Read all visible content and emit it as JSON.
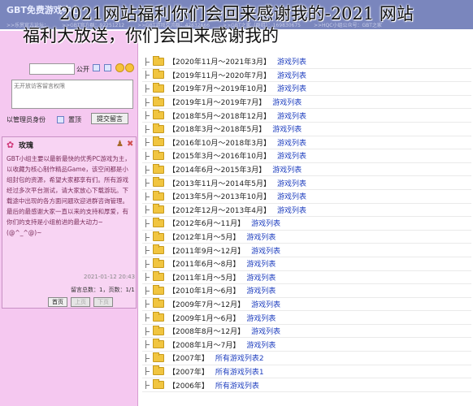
{
  "caption": {
    "line1": "2021网站福利你们会回来感谢我的-2021 网站",
    "line2": "福利大放送，你们会回来感谢我的"
  },
  "header": {
    "logo_text": "GBT免费游戏中心",
    "info_items": [
      ">>乐赏官方论坛：",
      ">>GBT官方群：92251212",
      ">>GBT游戏交流群：42632666",
      ">>GBT之家（群组）：169830675",
      ">>HQC小组公众号：GBT之家"
    ]
  },
  "sidebar": {
    "public_label": "公开",
    "textarea_placeholder": "无开放访客留言权限",
    "admin_only_label": "以管理员身份",
    "pin_label": "置顶",
    "submit_label": "提交留言",
    "message": {
      "author": "玫瑰",
      "text": "GBT小组主要以最新最快的优秀PC游戏为主，以收藏为核心制作精品Game，该空间都是小组封包的资源，希望大家都享有们。所有游戏经过多次平台测试，请大家放心下载游玩。下载途中出现的各方面问题欢迎进群咨询管理。最后的最感谢大家一直以来的支持和厚爱，有你们的支持是小组前进的最大动力~(@^_^@)~",
      "time": "2021-01-12 20:43",
      "stats": "留言总数：1，页数：1/1"
    },
    "pager": {
      "first": "首页",
      "prev": "上页",
      "next": "下页"
    }
  },
  "file_list": {
    "link_label": "游戏列表",
    "rows": [
      {
        "period": "【2020年11月～2021年3月】",
        "link": "游戏列表"
      },
      {
        "period": "【2019年11月～2020年7月】",
        "link": "游戏列表"
      },
      {
        "period": "【2019年7月～2019年10月】",
        "link": "游戏列表"
      },
      {
        "period": "【2019年1月～2019年7月】",
        "link": "游戏列表"
      },
      {
        "period": "【2018年5月～2018年12月】",
        "link": "游戏列表"
      },
      {
        "period": "【2018年3月～2018年5月】",
        "link": "游戏列表"
      },
      {
        "period": "【2016年10月～2018年3月】",
        "link": "游戏列表"
      },
      {
        "period": "【2015年3月～2016年10月】",
        "link": "游戏列表"
      },
      {
        "period": "【2014年6月～2015年3月】",
        "link": "游戏列表"
      },
      {
        "period": "【2013年11月～2014年5月】",
        "link": "游戏列表"
      },
      {
        "period": "【2013年5月～2013年10月】",
        "link": "游戏列表"
      },
      {
        "period": "【2012年12月～2013年4月】",
        "link": "游戏列表"
      },
      {
        "period": "【2012年6月～11月】",
        "link": "游戏列表"
      },
      {
        "period": "【2012年1月～5月】",
        "link": "游戏列表"
      },
      {
        "period": "【2011年9月～12月】",
        "link": "游戏列表"
      },
      {
        "period": "【2011年6月～8月】",
        "link": "游戏列表"
      },
      {
        "period": "【2011年1月～5月】",
        "link": "游戏列表"
      },
      {
        "period": "【2010年1月～6月】",
        "link": "游戏列表"
      },
      {
        "period": "【2009年7月～12月】",
        "link": "游戏列表"
      },
      {
        "period": "【2009年1月～6月】",
        "link": "游戏列表"
      },
      {
        "period": "【2008年8月～12月】",
        "link": "游戏列表"
      },
      {
        "period": "【2008年1月～7月】",
        "link": "游戏列表"
      },
      {
        "period": "【2007年】",
        "link": "所有游戏列表2"
      },
      {
        "period": "【2007年】",
        "link": "所有游戏列表1"
      },
      {
        "period": "【2006年】",
        "link": "所有游戏列表"
      }
    ]
  }
}
